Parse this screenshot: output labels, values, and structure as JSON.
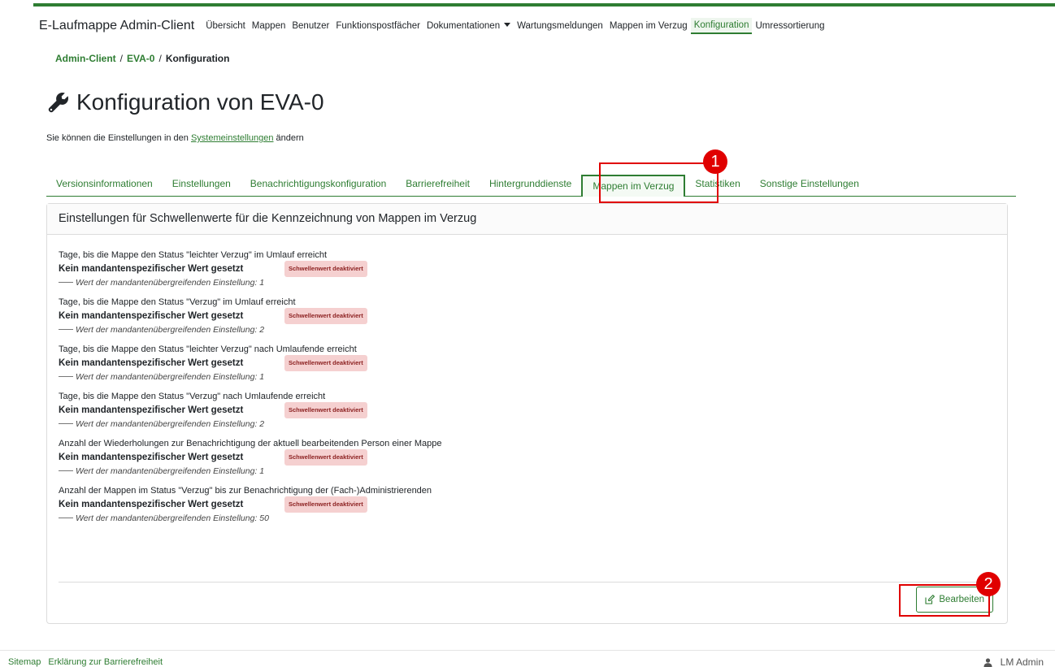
{
  "colors": {
    "accent": "#2e7d32",
    "highlight": "#e00000",
    "badge_bg": "#f5d0d0",
    "badge_text": "#8b1f1f"
  },
  "navbar": {
    "brand": "E-Laufmappe Admin-Client",
    "items": [
      {
        "label": "Übersicht"
      },
      {
        "label": "Mappen"
      },
      {
        "label": "Benutzer"
      },
      {
        "label": "Funktionspostfächer"
      },
      {
        "label": "Dokumentationen"
      },
      {
        "label": "Wartungsmeldungen"
      },
      {
        "label": "Mappen im Verzug"
      },
      {
        "label": "Konfiguration"
      },
      {
        "label": "Umressortierung"
      }
    ]
  },
  "breadcrumb": {
    "items": [
      "Admin-Client",
      "EVA-0",
      "Konfiguration"
    ],
    "separator": "/"
  },
  "page": {
    "title_icon": "wrench-icon",
    "title": "Konfiguration von EVA-0",
    "hint_before": "Sie können die Einstellungen in den ",
    "hint_link": "Systemeinstellungen",
    "hint_after": " ändern"
  },
  "tabs": [
    {
      "label": "Versionsinformationen"
    },
    {
      "label": "Einstellungen"
    },
    {
      "label": "Benachrichtigungskonfiguration"
    },
    {
      "label": "Barrierefreiheit"
    },
    {
      "label": "Hintergrunddienste"
    },
    {
      "label": "Mappen im Verzug"
    },
    {
      "label": "Statistiken"
    },
    {
      "label": "Sonstige Einstellungen"
    }
  ],
  "card": {
    "header": "Einstellungen für Schwellenwerte für die Kennzeichnung von Mappen im Verzug",
    "settings": [
      {
        "label": "Tage, bis die Mappe den Status \"leichter Verzug\" im Umlauf erreicht",
        "value": "Kein mandantenspezifischer Wert gesetzt",
        "badge": "Schwellenwert deaktiviert",
        "global": "Wert der mandantenübergreifenden Einstellung: 1"
      },
      {
        "label": "Tage, bis die Mappe den Status \"Verzug\" im Umlauf erreicht",
        "value": "Kein mandantenspezifischer Wert gesetzt",
        "badge": "Schwellenwert deaktiviert",
        "global": "Wert der mandantenübergreifenden Einstellung: 2"
      },
      {
        "label": "Tage, bis die Mappe den Status \"leichter Verzug\" nach Umlaufende erreicht",
        "value": "Kein mandantenspezifischer Wert gesetzt",
        "badge": "Schwellenwert deaktiviert",
        "global": "Wert der mandantenübergreifenden Einstellung: 1"
      },
      {
        "label": "Tage, bis die Mappe den Status \"Verzug\" nach Umlaufende erreicht",
        "value": "Kein mandantenspezifischer Wert gesetzt",
        "badge": "Schwellenwert deaktiviert",
        "global": "Wert der mandantenübergreifenden Einstellung: 2"
      },
      {
        "label": "Anzahl der Wiederholungen zur Benachrichtigung der aktuell bearbeitenden Person einer Mappe",
        "value": "Kein mandantenspezifischer Wert gesetzt",
        "badge": "Schwellenwert deaktiviert",
        "global": "Wert der mandantenübergreifenden Einstellung: 1"
      },
      {
        "label": "Anzahl der Mappen im Status \"Verzug\" bis zur Benachrichtigung der (Fach-)Administrierenden",
        "value": "Kein mandantenspezifischer Wert gesetzt",
        "badge": "Schwellenwert deaktiviert",
        "global": "Wert der mandantenübergreifenden Einstellung: 50"
      }
    ],
    "edit_button": "Bearbeiten",
    "edit_icon": "edit-icon"
  },
  "markers": [
    "1",
    "2"
  ],
  "footer": {
    "links": [
      "Sitemap",
      "Erklärung zur Barrierefreiheit"
    ],
    "user": "LM Admin",
    "user_icon": "user-icon"
  }
}
